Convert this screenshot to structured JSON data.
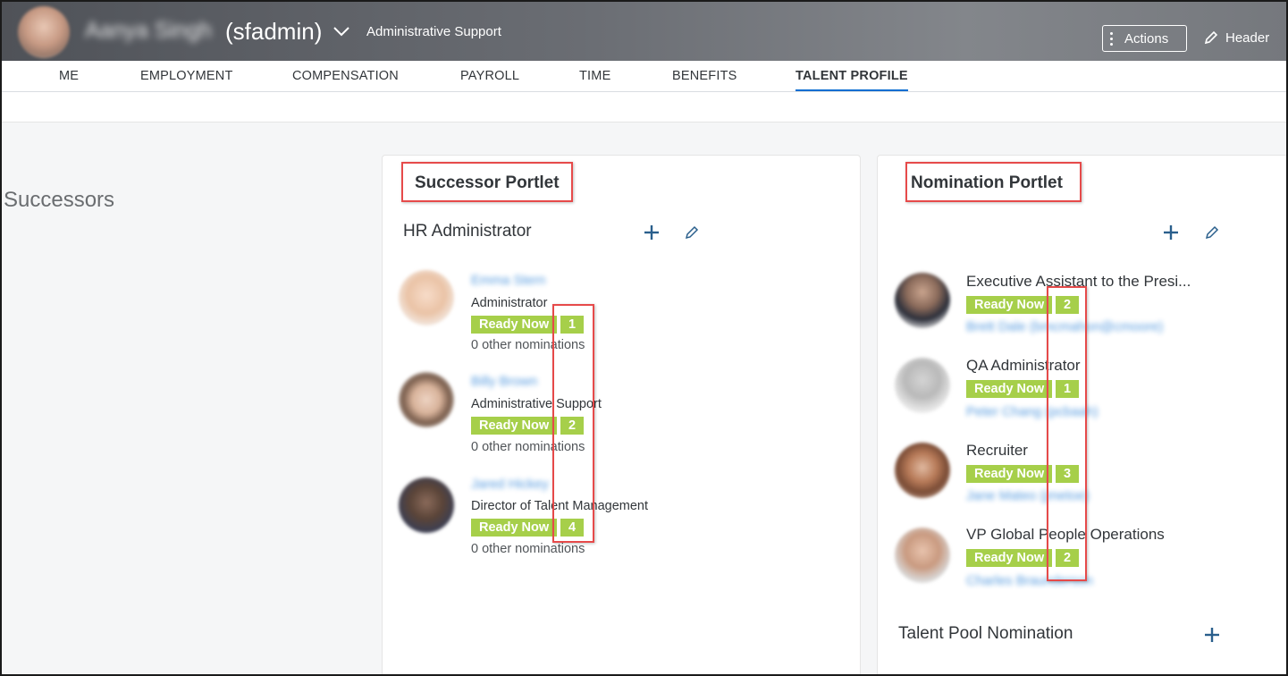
{
  "header": {
    "user_name": "Aanya Singh",
    "user_id": "(sfadmin)",
    "role": "Administrative Support",
    "actions_label": "Actions",
    "header_label": "Header"
  },
  "tabs": [
    {
      "label": "ME"
    },
    {
      "label": "EMPLOYMENT"
    },
    {
      "label": "COMPENSATION"
    },
    {
      "label": "PAYROLL"
    },
    {
      "label": "TIME"
    },
    {
      "label": "BENEFITS"
    },
    {
      "label": "TALENT PROFILE",
      "active": true
    }
  ],
  "section": {
    "title": "Successors"
  },
  "successor_portlet": {
    "title": "Successor Portlet",
    "position": "HR Administrator",
    "successors": [
      {
        "name": "Emma Stern",
        "title": "Administrator",
        "readiness": "Ready Now",
        "rank": "1",
        "other": "0 other nominations"
      },
      {
        "name": "Billy Brown",
        "title": "Administrative Support",
        "readiness": "Ready Now",
        "rank": "2",
        "other": "0 other nominations"
      },
      {
        "name": "Jared Hickey",
        "title": "Director of Talent Management",
        "readiness": "Ready Now",
        "rank": "4",
        "other": "0 other nominations"
      }
    ]
  },
  "nomination_portlet": {
    "title": "Nomination Portlet",
    "nominations": [
      {
        "position": "Executive Assistant to the Presi...",
        "readiness": "Ready Now",
        "rank": "2",
        "incumbent": "Brett Dale (bmcmahon@cmoore)"
      },
      {
        "position": "QA Administrator",
        "readiness": "Ready Now",
        "rank": "1",
        "incumbent": "Peter Chang (pcbaah)"
      },
      {
        "position": "Recruiter",
        "readiness": "Ready Now",
        "rank": "3",
        "incumbent": "Jane Mateo (jmetoe)"
      },
      {
        "position": "VP Global People Operations",
        "readiness": "Ready Now",
        "rank": "2",
        "incumbent": "Charles Braunderson"
      }
    ],
    "talent_pool_label": "Talent Pool Nomination"
  },
  "colors": {
    "accent": "#0a6ed1",
    "ready_badge": "#a6cf4a",
    "highlight_box": "#e64a4a"
  }
}
